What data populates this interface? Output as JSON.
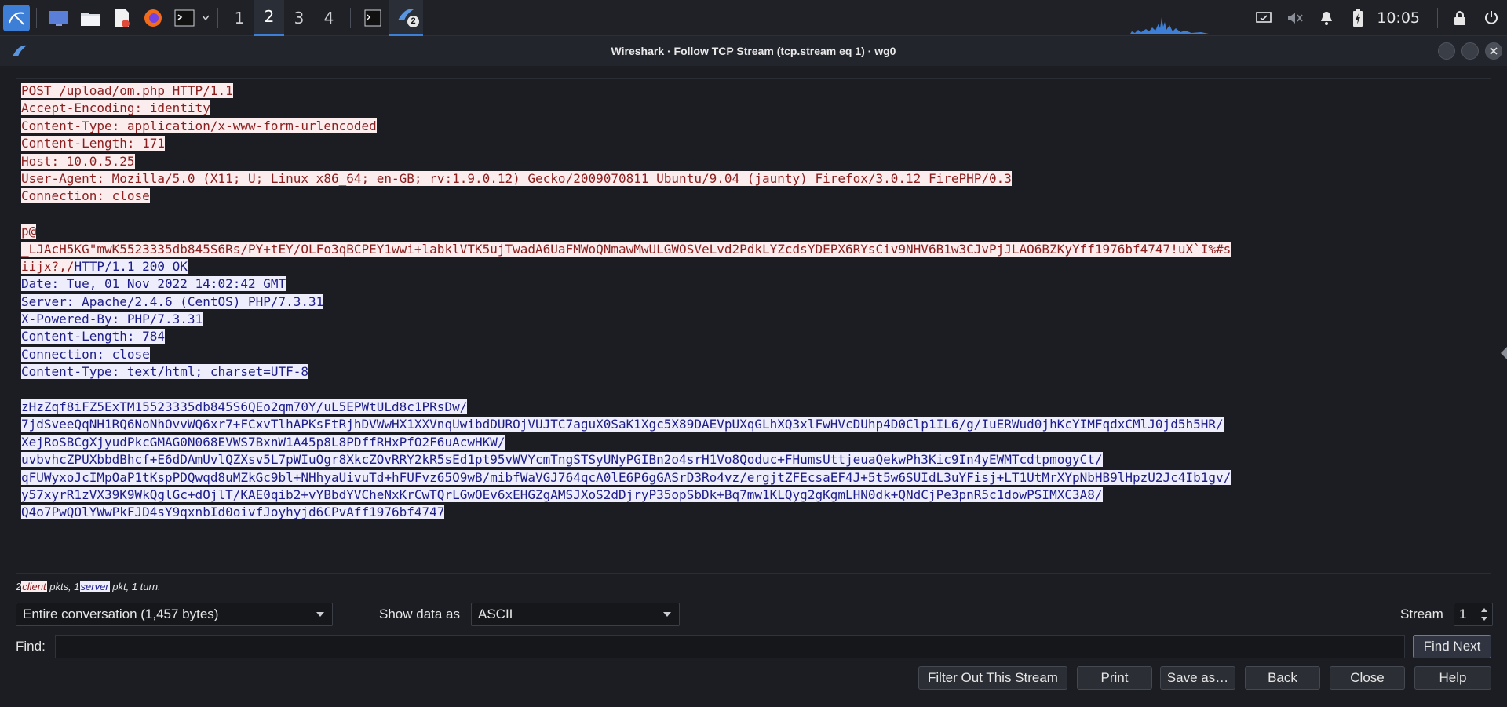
{
  "taskbar": {
    "workspaces": [
      "1",
      "2",
      "3",
      "4"
    ],
    "active_workspace": "2",
    "wireshark_badge": "2",
    "clock": "10:05",
    "icons": [
      "kali-menu-icon",
      "desktop-icon",
      "file-manager-icon",
      "text-editor-icon",
      "firefox-icon",
      "terminal-icon",
      "terminal-window-icon",
      "wireshark-icon",
      "network-monitor-graph",
      "notifications-icon",
      "mute-icon",
      "bell-icon",
      "battery-icon",
      "lock-icon",
      "power-icon"
    ]
  },
  "window": {
    "title": "Wireshark · Follow TCP Stream (tcp.stream eq 1) · wg0"
  },
  "stream": {
    "client_request": [
      "POST /upload/om.php HTTP/1.1",
      "Accept-Encoding: identity",
      "Content-Type: application/x-www-form-urlencoded",
      "Content-Length: 171",
      "Host: 10.0.5.25",
      "User-Agent: Mozilla/5.0 (X11; U; Linux x86_64; en-GB; rv:1.9.0.12) Gecko/2009070811 Ubuntu/9.04 (jaunty) Firefox/3.0.12 FirePHP/0.3",
      "Connection: close"
    ],
    "client_body": [
      "p@",
      "_LJAcH5KG\"mwK5523335db845S6Rs/PY+tEY/OLFo3qBCPEY1wwi+labklVTK5ujTwadA6UaFMWoQNmawMwULGWOSVeLvd2PdkLYZcdsYDEPX6RYsCiv9NHV6B1w3CJvPjJLAO6BZKyYff1976bf4747!uX`I%#s"
    ],
    "server_first_line_prefix": "iijx?,/",
    "server_first_line_rest": "HTTP/1.1 200 OK",
    "server_headers": [
      "Date: Tue, 01 Nov 2022 14:02:42 GMT",
      "Server: Apache/2.4.6 (CentOS) PHP/7.3.31",
      "X-Powered-By: PHP/7.3.31",
      "Content-Length: 784",
      "Connection: close",
      "Content-Type: text/html; charset=UTF-8"
    ],
    "server_body": [
      "zHzZqf8iFZ5ExTM15523335db845S6QEo2qm70Y/uL5EPWtULd8c1PRsDw/",
      "7jdSveeQqNH1RQ6NoNhOvvWQ6xr7+FCxvTlhAPKsFtRjhDVWwHX1XXVnqUwibdDUROjVUJTC7aguX0SaK1Xgc5X89DAEVpUXqGLhXQ3xlFwHVcDUhp4D0Clp1IL6/g/IuERWud0jhKcYIMFqdxCMlJ0jd5h5HR/",
      "XejRoSBCgXjyudPkcGMAG0N068EVWS7BxnW1A45p8L8PDffRHxPfO2F6uAcwHKW/",
      "uvbvhcZPUXbbdBhcf+E6dDAmUvlQZXsv5L7pWIuOgr8XkcZOvRRY2kR5sEd1pt95vWVYcmTngSTSyUNyPGIBn2o4srH1Vo8Qoduc+FHumsUttjeuaQekwPh3Kic9In4yEWMTcdtpmogyCt/",
      "qFUWyxoJcIMpOaP1tKspPDQwqd8uMZkGc9bl+NHhyaUivuTd+hFUFvz65O9wB/mibfWaVGJ764qcA0lE6P6gGASrD3Ro4vz/ergjtZFEcsaEF4J+5t5w6SUIdL3uYFisj+LT1UtMrXYpNbHB9lHpzU2Jc4Ib1gv/",
      "y57xyrR1zVX39K9WkQglGc+dOjlT/KAE0qib2+vYBbdYVCheNxKrCwTQrLGwOEv6xEHGZgAMSJXoS2dDjryP35opSbDk+Bq7mw1KLQyg2gKgmLHN0dk+QNdCjPe3pnR5c1dowPSIMXC3A8/",
      "Q4o7PwQOlYWwPkFJD4sY9qxnbId0oivfJoyhyjd6CPvAff1976bf4747"
    ]
  },
  "summary": {
    "client_count": "2",
    "client_word": "client",
    "mid": "pkts, 1",
    "server_word": "server",
    "tail": "pkt, 1 turn."
  },
  "controls": {
    "conversation_select": "Entire conversation (1,457 bytes)",
    "show_data_label": "Show data as",
    "show_data_select": "ASCII",
    "stream_label": "Stream",
    "stream_value": "1",
    "find_label": "Find:",
    "find_value": "",
    "find_next": "Find Next"
  },
  "buttons": {
    "filter_out": "Filter Out This Stream",
    "print": "Print",
    "save_as": "Save as…",
    "back": "Back",
    "close": "Close",
    "help": "Help"
  },
  "colors": {
    "client_bg": "#fbeded",
    "client_fg": "#8b1e1e",
    "server_bg": "#ededfb",
    "server_fg": "#1d1d8a",
    "accent": "#3d7fd6"
  }
}
